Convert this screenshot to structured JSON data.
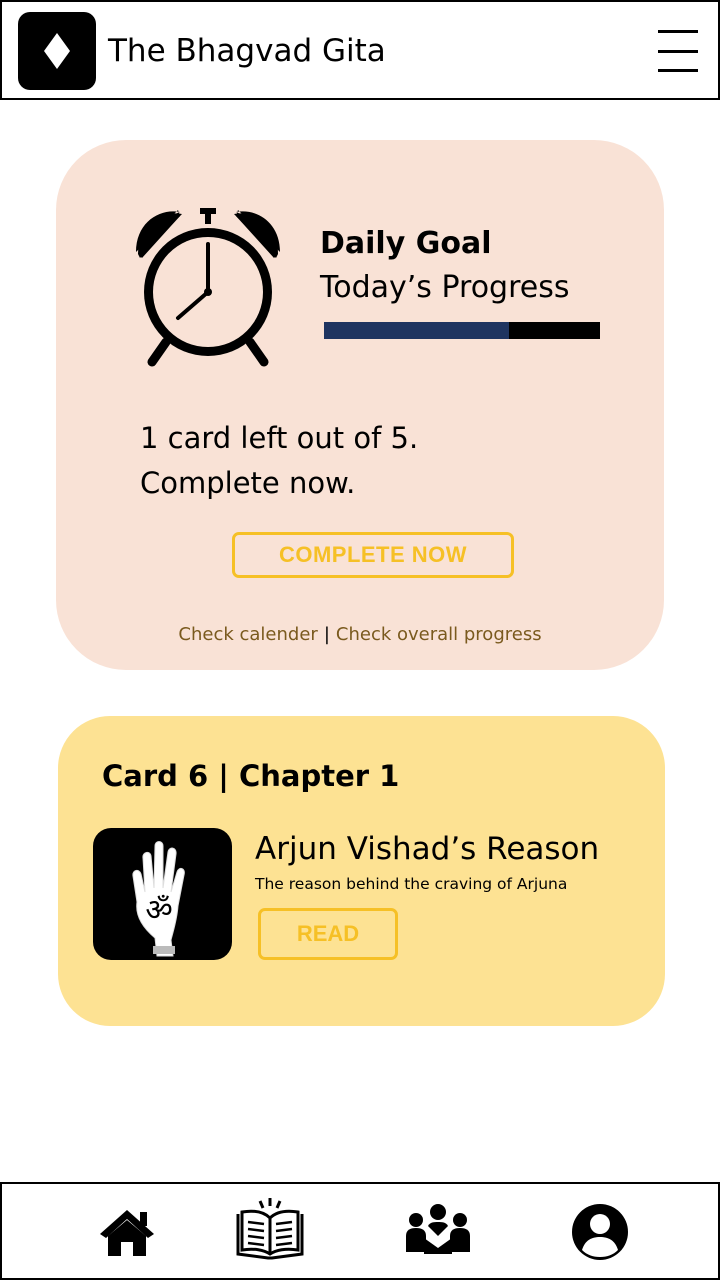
{
  "header": {
    "title": "The Bhagvad Gita",
    "logo_icon": "diamond-logo-icon",
    "menu_icon": "hamburger-menu-icon"
  },
  "goal_card": {
    "icon": "alarm-clock-icon",
    "title": "Daily Goal",
    "subtitle": "Today’s Progress",
    "progress_fraction": 0.67,
    "message_line1": "1 card left out of 5.",
    "message_line2": "Complete now.",
    "button_label": "COMPLETE NOW",
    "links": {
      "calendar": "Check calender",
      "separator": "|",
      "overall": "Check overall progress"
    }
  },
  "lesson_card": {
    "heading": "Card 6 | Chapter 1",
    "thumbnail_icon": "om-hand-icon",
    "title": "Arjun Vishad’s Reason",
    "description": "The reason behind the craving of Arjuna",
    "button_label": "READ"
  },
  "bottom_nav": {
    "items": [
      {
        "icon": "home-icon"
      },
      {
        "icon": "book-icon"
      },
      {
        "icon": "community-icon"
      },
      {
        "icon": "profile-icon"
      }
    ]
  },
  "colors": {
    "goal_card_bg": "#f9e2d6",
    "lesson_card_bg": "#fde293",
    "accent": "#f6c026",
    "progress_fill": "#1f3460",
    "progress_track": "#000000"
  }
}
